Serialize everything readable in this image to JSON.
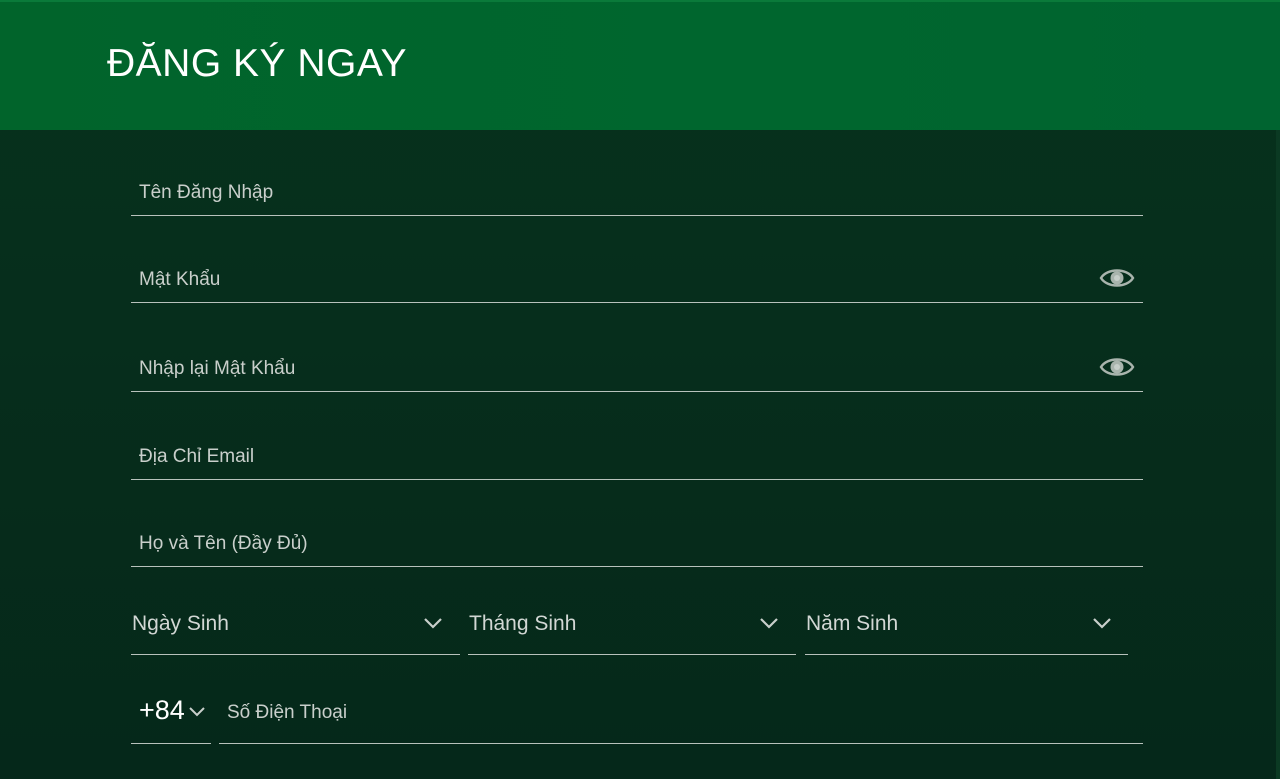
{
  "header": {
    "title": "ĐĂNG KÝ NGAY"
  },
  "form": {
    "username": {
      "placeholder": "Tên Đăng Nhập",
      "value": ""
    },
    "password": {
      "placeholder": "Mật Khẩu",
      "value": "",
      "toggle_icon": "eye-icon"
    },
    "confirm_password": {
      "placeholder": "Nhập lại Mật Khẩu",
      "value": "",
      "toggle_icon": "eye-icon"
    },
    "email": {
      "placeholder": "Địa Chỉ Email",
      "value": ""
    },
    "full_name": {
      "placeholder": "Họ và Tên (Đầy Đủ)",
      "value": ""
    },
    "birth_day": {
      "label": "Ngày Sinh",
      "icon": "chevron-down-icon"
    },
    "birth_month": {
      "label": "Tháng Sinh",
      "icon": "chevron-down-icon"
    },
    "birth_year": {
      "label": "Năm Sinh",
      "icon": "chevron-down-icon"
    },
    "phone_code": {
      "value": "+84",
      "icon": "chevron-down-icon"
    },
    "phone": {
      "placeholder": "Số Điện Thoại",
      "value": ""
    }
  },
  "colors": {
    "header_bg": "#00662e",
    "page_bg": "#062a19",
    "line": "#b8c2bc",
    "text": "#d2d7d4"
  }
}
